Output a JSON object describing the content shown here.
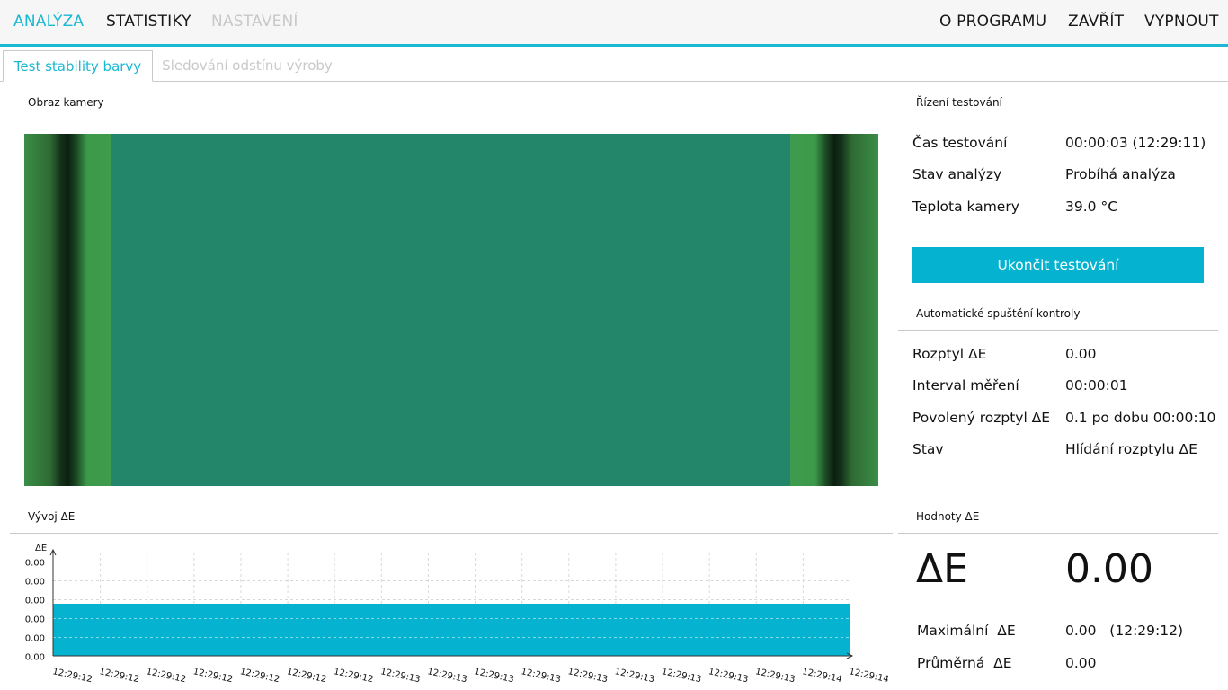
{
  "topbar": {
    "left_items": [
      {
        "label": "ANALÝZA",
        "state": "active"
      },
      {
        "label": "STATISTIKY",
        "state": "normal"
      },
      {
        "label": "NASTAVENÍ",
        "state": "disabled"
      }
    ],
    "right_items": [
      {
        "label": "O PROGRAMU"
      },
      {
        "label": "ZAVŘÍT"
      },
      {
        "label": "VYPNOUT"
      }
    ]
  },
  "tabs": [
    {
      "label": "Test stability barvy",
      "active": true
    },
    {
      "label": "Sledování odstínu výroby",
      "active": false
    }
  ],
  "camera": {
    "title": "Obraz kamery"
  },
  "control": {
    "title": "Řízení testování",
    "rows": [
      {
        "label": "Čas testování",
        "value": "00:00:03 (12:29:11)"
      },
      {
        "label": "Stav analýzy",
        "value": "Probíhá analýza"
      },
      {
        "label": "Teplota kamery",
        "value": "39.0 °C"
      }
    ],
    "stop_button": "Ukončit testování"
  },
  "auto": {
    "title": "Automatické spuštění kontroly",
    "rows": [
      {
        "label": "Rozptyl ΔE",
        "value": "0.00"
      },
      {
        "label": "Interval měření",
        "value": "00:00:01"
      },
      {
        "label": "Povolený rozptyl ΔE",
        "value": "0.1 po dobu 00:00:10"
      },
      {
        "label": "Stav",
        "value": "Hlídání rozptylu ΔE"
      }
    ]
  },
  "trend": {
    "title": "Vývoj ΔE"
  },
  "values": {
    "title": "Hodnoty ΔE",
    "big_label": "ΔE",
    "big_value": "0.00",
    "max_label": "Maximální  ΔE",
    "max_value": "0.00   (12:29:12)",
    "avg_label": "Průměrná  ΔE",
    "avg_value": "0.00"
  },
  "colors": {
    "accent": "#1ab8d2",
    "button": "#05b3d0",
    "area": "#05b3d0"
  },
  "chart_data": {
    "type": "area",
    "ylabel": "ΔE",
    "y_tick_labels": [
      "0.00",
      "0.00",
      "0.00",
      "0.00",
      "0.00",
      "0.00"
    ],
    "x_tick_labels": [
      "12:29:12",
      "12:29:12",
      "12:29:12",
      "12:29:12",
      "12:29:12",
      "12:29:12",
      "12:29:12",
      "12:29:13",
      "12:29:13",
      "12:29:13",
      "12:29:13",
      "12:29:13",
      "12:29:13",
      "12:29:13",
      "12:29:13",
      "12:29:13",
      "12:29:14",
      "12:29:14"
    ],
    "series": [
      {
        "values": [
          0.0,
          0.0,
          0.0,
          0.0,
          0.0,
          0.0,
          0.0,
          0.0,
          0.0,
          0.0,
          0.0,
          0.0,
          0.0,
          0.0,
          0.0,
          0.0,
          0.0,
          0.0
        ]
      }
    ],
    "grid": true
  }
}
